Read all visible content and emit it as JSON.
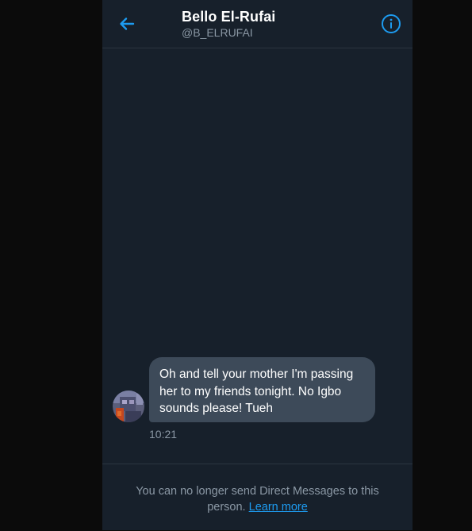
{
  "header": {
    "title": "Bello El-Rufai",
    "handle": "@B_ELRUFAI",
    "back_icon": "arrow-left-icon",
    "info_icon": "info-circle-icon"
  },
  "conversation": {
    "messages": [
      {
        "text": "Oh and tell your mother I'm passing her to my friends tonight. No Igbo sounds please! Tueh",
        "time": "10:21"
      }
    ]
  },
  "footer": {
    "notice": "You can no longer send Direct Messages to this person.",
    "link_label": "Learn more"
  },
  "colors": {
    "background": "#17202b",
    "bubble": "#3d4a59",
    "accent": "#1d9bf0",
    "muted": "#8b98a5"
  }
}
